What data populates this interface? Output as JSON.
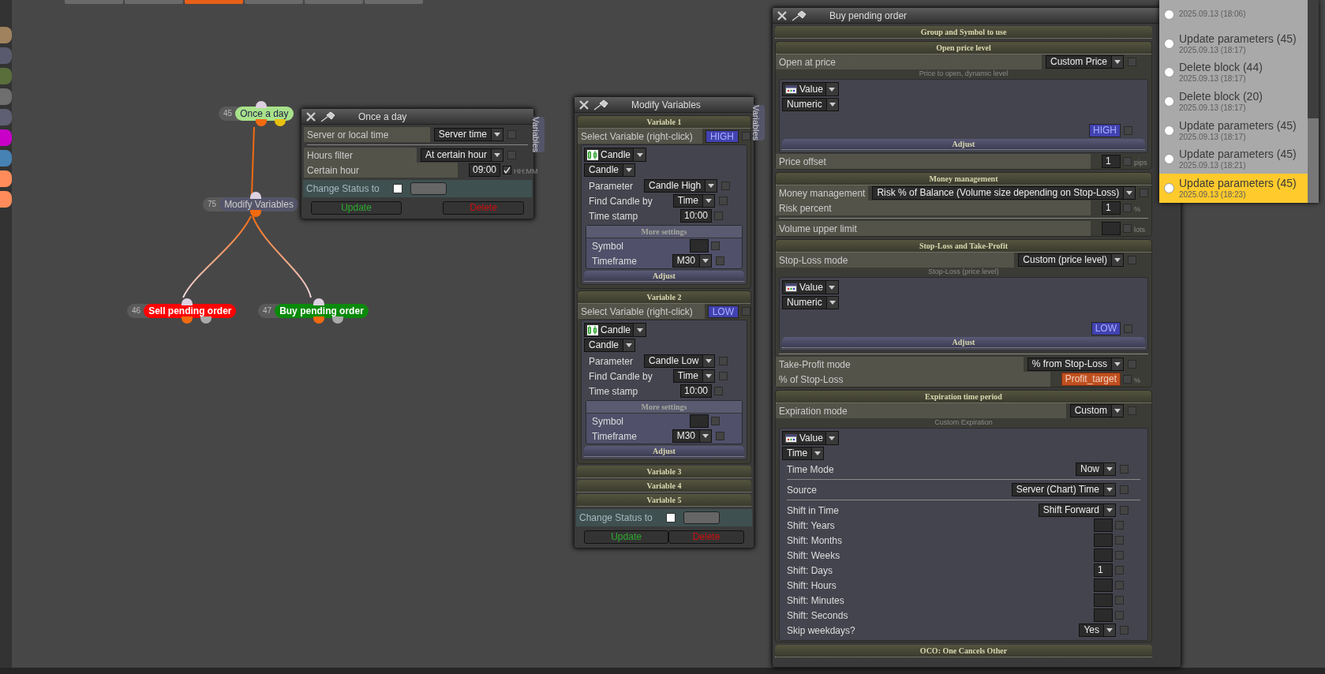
{
  "top_tabs": [
    {
      "selected": false
    },
    {
      "selected": false
    },
    {
      "selected": true
    },
    {
      "selected": false
    },
    {
      "selected": false
    },
    {
      "selected": false
    }
  ],
  "palette": [
    {
      "color": "#a0825f"
    },
    {
      "color": "#5a5a6e"
    },
    {
      "color": "#5a6e3c"
    },
    {
      "color": "#6e6e6e"
    },
    {
      "color": "#5f5f73"
    },
    {
      "color": "#c800c8"
    },
    {
      "color": "#4682b4"
    },
    {
      "color": "#ff8c5a"
    },
    {
      "color": "#ff8c5a"
    }
  ],
  "nodes": [
    {
      "number": "45",
      "title": "Once a day",
      "kind": "trigger"
    },
    {
      "number": "75",
      "title": "Modify Variables",
      "kind": "action"
    },
    {
      "number": "46",
      "title": "Sell pending order",
      "kind": "sell"
    },
    {
      "number": "47",
      "title": "Buy pending order",
      "kind": "buy"
    }
  ],
  "once_panel": {
    "title": "Once a day",
    "side_tab": "Variables",
    "rows": [
      {
        "kind": "select",
        "label": "Server or local time",
        "value": "Server time",
        "checked": false
      },
      {
        "kind": "divider"
      },
      {
        "kind": "select",
        "label": "Hours filter",
        "value": "At certain hour",
        "checked": false
      },
      {
        "kind": "input",
        "label": "Certain hour",
        "value": "09:00",
        "checked": true,
        "unit": "HH:MM"
      }
    ],
    "change_status": {
      "label": "Change Status to",
      "checked": false
    },
    "update": "Update",
    "delete": "Delete"
  },
  "modify_panel": {
    "title": "Modify Variables",
    "side_tab": "Variables",
    "variables": [
      {
        "title": "Variable 1",
        "expanded": true,
        "select_label": "Select Variable (right-click)",
        "tag": "HIGH",
        "checked": false,
        "block": {
          "kind": "candle",
          "value_type": "Candle",
          "value_subtype": "Candle",
          "rows": [
            {
              "kind": "select",
              "label": "Parameter",
              "value": "Candle High",
              "checked": false
            },
            {
              "kind": "select",
              "label": "Find Candle by",
              "value": "Time",
              "checked": false
            },
            {
              "kind": "input",
              "label": "Time stamp",
              "value": "10:00",
              "checked": false
            }
          ],
          "more": {
            "title": "More settings",
            "rows": [
              {
                "kind": "input",
                "label": "Symbol",
                "checked": false
              },
              {
                "kind": "select",
                "label": "Timeframe",
                "value": "M30",
                "checked": false
              }
            ]
          },
          "adjust": "Adjust"
        }
      },
      {
        "title": "Variable 2",
        "expanded": true,
        "select_label": "Select Variable (right-click)",
        "tag": "LOW",
        "checked": false,
        "block": {
          "kind": "candle",
          "value_type": "Candle",
          "value_subtype": "Candle",
          "rows": [
            {
              "kind": "select",
              "label": "Parameter",
              "value": "Candle Low",
              "checked": false
            },
            {
              "kind": "select",
              "label": "Find Candle by",
              "value": "Time",
              "checked": false
            },
            {
              "kind": "input",
              "label": "Time stamp",
              "value": "10:00",
              "checked": false
            }
          ],
          "more": {
            "title": "More settings",
            "rows": [
              {
                "kind": "input",
                "label": "Symbol",
                "checked": false
              },
              {
                "kind": "select",
                "label": "Timeframe",
                "value": "M30",
                "checked": false
              }
            ]
          },
          "adjust": "Adjust"
        }
      },
      {
        "title": "Variable 3",
        "expanded": false
      },
      {
        "title": "Variable 4",
        "expanded": false
      },
      {
        "title": "Variable 5",
        "expanded": false
      }
    ],
    "change_status": {
      "label": "Change Status to",
      "checked": false
    },
    "update": "Update",
    "delete": "Delete"
  },
  "buy_panel": {
    "title": "Buy pending order",
    "sections": [
      {
        "title": "Group and Symbol to use"
      },
      {
        "title": "Open price level",
        "rows": [
          {
            "kind": "select",
            "label": "Open at price",
            "value": "Custom Price",
            "checked": false
          },
          {
            "kind": "caption",
            "text": "Price to open, dynamic level"
          },
          {
            "kind": "block",
            "block": {
              "kind": "value",
              "value_type": "Value",
              "value_subtype": "Numeric",
              "tag": "HIGH",
              "tag_checked": false,
              "adjust": "Adjust"
            }
          },
          {
            "kind": "input",
            "label": "Price offset",
            "value": "1",
            "checked": false,
            "unit": "pips"
          }
        ]
      },
      {
        "title": "Money management",
        "rows": [
          {
            "kind": "select",
            "label": "Money management",
            "value": "Risk % of Balance (Volume size depending on Stop-Loss)",
            "checked": false
          },
          {
            "kind": "input",
            "label": "Risk percent",
            "value": "1",
            "checked": false,
            "unit": "%"
          },
          {
            "kind": "divider"
          },
          {
            "kind": "input",
            "label": "Volume upper limit",
            "checked": false,
            "unit": "lots"
          }
        ]
      },
      {
        "title": "Stop-Loss and Take-Profit",
        "rows": [
          {
            "kind": "select",
            "label": "Stop-Loss mode",
            "value": "Custom (price level)",
            "checked": false
          },
          {
            "kind": "caption",
            "text": "Stop-Loss (price level)"
          },
          {
            "kind": "block",
            "block": {
              "kind": "value",
              "value_type": "Value",
              "value_subtype": "Numeric",
              "tag": "LOW",
              "tag_checked": false,
              "adjust": "Adjust"
            }
          },
          {
            "kind": "divider"
          },
          {
            "kind": "select",
            "label": "Take-Profit mode",
            "value": "% from Stop-Loss",
            "checked": false
          },
          {
            "kind": "var_input",
            "label": "% of Stop-Loss",
            "value": "Profit_target",
            "checked": false,
            "unit": "%"
          }
        ]
      },
      {
        "title": "Expiration time period",
        "rows": [
          {
            "kind": "select",
            "label": "Expiration mode",
            "value": "Custom",
            "checked": false
          },
          {
            "kind": "caption",
            "text": "Custom Expiration"
          },
          {
            "kind": "block",
            "block": {
              "kind": "value",
              "value_type": "Value",
              "value_subtype": "Time",
              "rows": [
                {
                  "kind": "select",
                  "label": "Time Mode",
                  "value": "Now",
                  "checked": false
                },
                {
                  "kind": "divider"
                },
                {
                  "kind": "select",
                  "label": "Source",
                  "value": "Server (Chart) Time",
                  "checked": false
                },
                {
                  "kind": "divider"
                },
                {
                  "kind": "select",
                  "label": "Shift in Time",
                  "value": "Shift Forward",
                  "checked": false
                },
                {
                  "kind": "input",
                  "label": "Shift: Years",
                  "checked": false
                },
                {
                  "kind": "input",
                  "label": "Shift: Months",
                  "checked": false
                },
                {
                  "kind": "input",
                  "label": "Shift: Weeks",
                  "checked": false
                },
                {
                  "kind": "input",
                  "label": "Shift: Days",
                  "value": "1",
                  "checked": false
                },
                {
                  "kind": "input",
                  "label": "Shift: Hours",
                  "checked": false
                },
                {
                  "kind": "input",
                  "label": "Shift: Minutes",
                  "checked": false
                },
                {
                  "kind": "input",
                  "label": "Shift: Seconds",
                  "checked": false
                },
                {
                  "kind": "select",
                  "label": "Skip weekdays?",
                  "value": "Yes",
                  "checked": false
                }
              ]
            }
          }
        ]
      },
      {
        "title": "OCO: One Cancels Other"
      }
    ]
  },
  "history": [
    {
      "date": "2025.09.13 (18:06)",
      "selected": false
    },
    {
      "title": "Update parameters (45)",
      "date": "2025.09.13 (18:17)",
      "selected": false
    },
    {
      "title": "Delete block (44)",
      "date": "2025.09.13 (18:17)",
      "selected": false
    },
    {
      "title": "Delete block (20)",
      "date": "2025.09.13 (18:17)",
      "selected": false
    },
    {
      "title": "Update parameters (45)",
      "date": "2025.09.13 (18:17)",
      "selected": false
    },
    {
      "title": "Update parameters (45)",
      "date": "2025.09.13 (18:21)",
      "selected": false
    },
    {
      "title": "Update parameters (45)",
      "date": "2025.09.13 (18:23)",
      "selected": true
    }
  ]
}
